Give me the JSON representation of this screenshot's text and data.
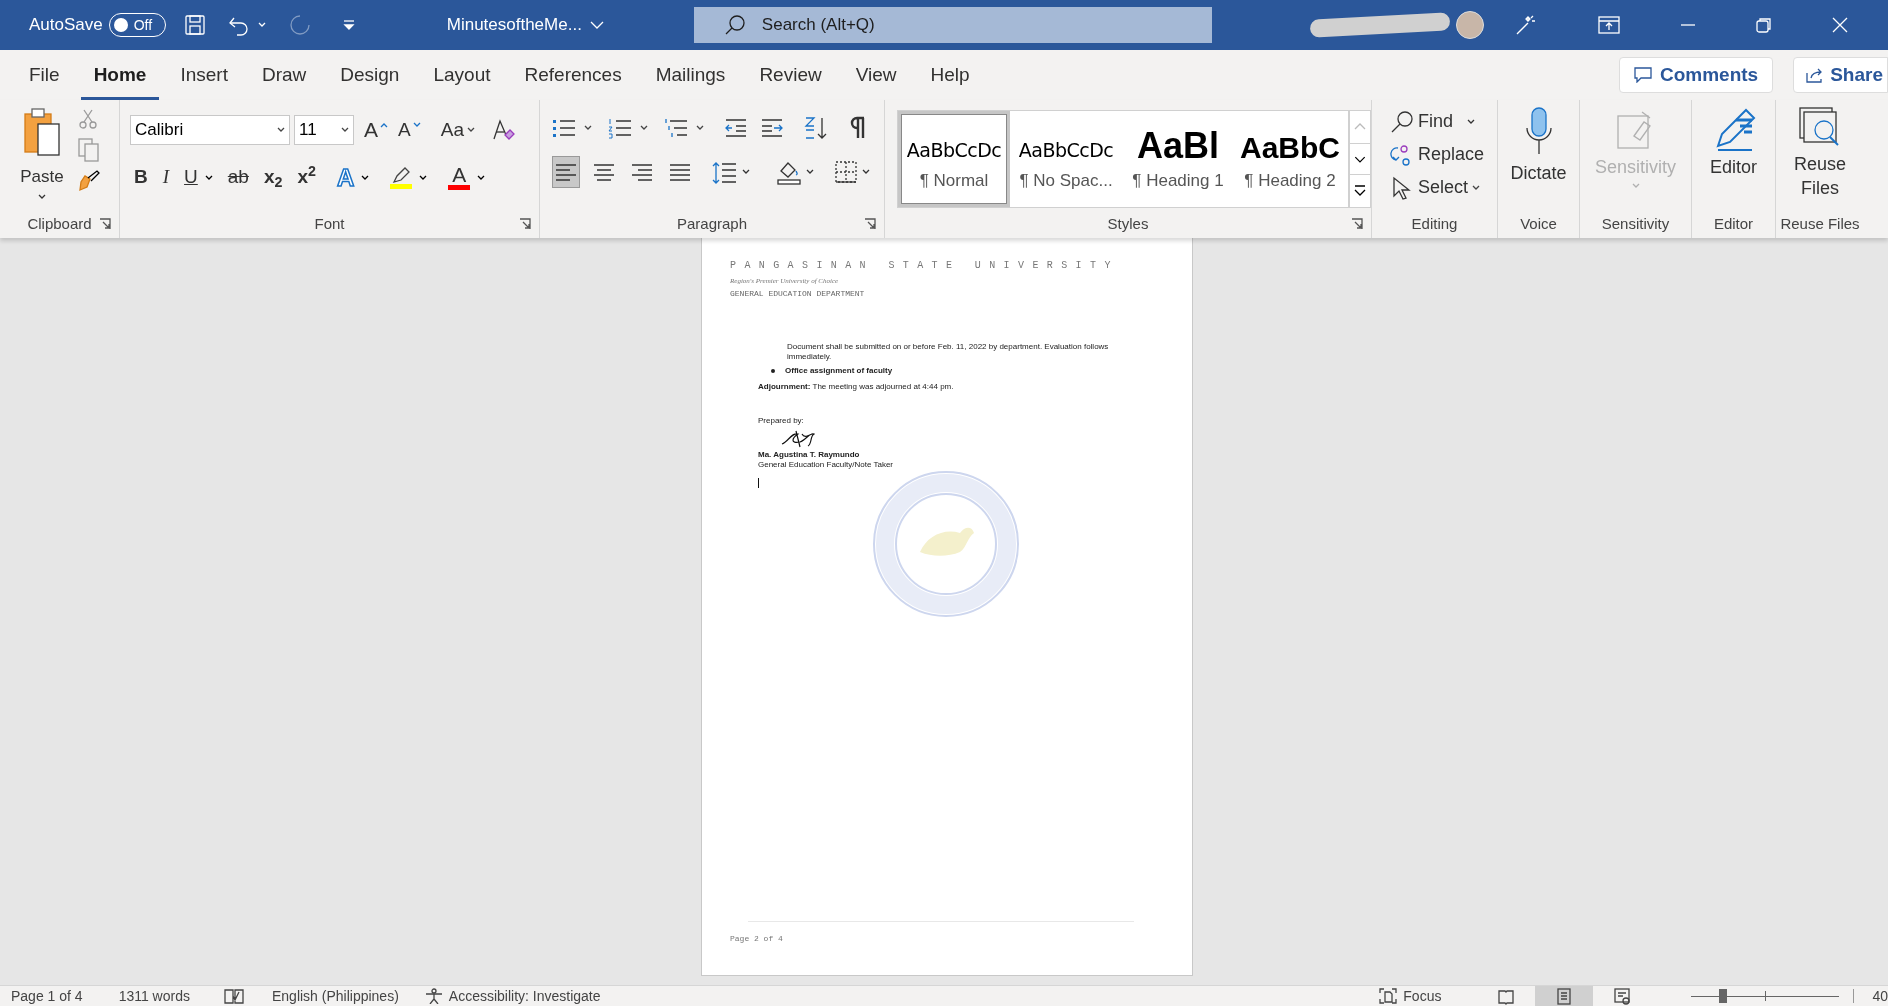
{
  "title_bar": {
    "autosave_label": "AutoSave",
    "autosave_toggle": {
      "label": "Off",
      "on": false
    },
    "document_title": "MinutesoftheMe...",
    "search": {
      "placeholder": "Search (Alt+Q)"
    }
  },
  "menu_tabs": [
    {
      "label": "File",
      "selected": false
    },
    {
      "label": "Home",
      "selected": true
    },
    {
      "label": "Insert",
      "selected": false
    },
    {
      "label": "Draw",
      "selected": false
    },
    {
      "label": "Design",
      "selected": false
    },
    {
      "label": "Layout",
      "selected": false
    },
    {
      "label": "References",
      "selected": false
    },
    {
      "label": "Mailings",
      "selected": false
    },
    {
      "label": "Review",
      "selected": false
    },
    {
      "label": "View",
      "selected": false
    },
    {
      "label": "Help",
      "selected": false
    }
  ],
  "comments_button": "Comments",
  "share_button": "Share",
  "ribbon": {
    "clipboard": {
      "paste": "Paste",
      "label": "Clipboard"
    },
    "font": {
      "font_name": "Calibri",
      "font_size": "11",
      "grow": "A",
      "shrink": "A",
      "change_case": "Aa",
      "format_buttons": [
        {
          "label": "B",
          "kind": "bold"
        },
        {
          "label": "I",
          "kind": "italic"
        },
        {
          "label": "U",
          "kind": "underline"
        },
        {
          "label": "ab",
          "kind": "strike"
        },
        {
          "label": "x$_{2}$",
          "kind": "sub"
        },
        {
          "label": "x$^{2}$",
          "kind": "sup"
        }
      ],
      "text_effects": "A",
      "font_color_label": "A",
      "label": "Font"
    },
    "paragraph": {
      "label": "Paragraph",
      "alignments": [
        {
          "kind": "left",
          "selected": true
        },
        {
          "kind": "center",
          "selected": false
        },
        {
          "kind": "right",
          "selected": false
        },
        {
          "kind": "justify",
          "selected": false
        }
      ]
    },
    "styles": {
      "items": [
        {
          "preview": "AaBbCcDc",
          "name": "¶ Normal",
          "kind": "body",
          "selected": true
        },
        {
          "preview": "AaBbCcDc",
          "name": "¶ No Spac...",
          "kind": "body",
          "selected": false
        },
        {
          "preview": "AaBl",
          "name": "¶ Heading 1",
          "kind": "heading1",
          "selected": false
        },
        {
          "preview": "AaBbC",
          "name": "¶ Heading 2",
          "kind": "heading2",
          "selected": false
        }
      ],
      "label": "Styles"
    },
    "editing": {
      "find": "Find",
      "replace": "Replace",
      "select": "Select",
      "label": "Editing"
    },
    "voice": {
      "button": "Dictate",
      "label": "Voice"
    },
    "sensitivity": {
      "button": "Sensitivity",
      "disabled": true,
      "label": "Sensitivity"
    },
    "editor": {
      "button": "Editor",
      "label": "Editor"
    },
    "reuse_files": {
      "button": "Reuse Files",
      "label": "Reuse Files"
    }
  },
  "document": {
    "header": {
      "university": "PANGASINAN STATE UNIVERSITY",
      "tagline": "Region's Premier University of Choice",
      "department": "GENERAL EDUCATION DEPARTMENT"
    },
    "body": [
      {
        "kind": "indented",
        "text": "Document shall be submitted on or before Feb. 11, 2022 by department. Evaluation follows immediately."
      },
      {
        "kind": "bullet",
        "text": "Office assignment of faculty"
      },
      {
        "kind": "paragraph",
        "text": "**Adjournment:** The meeting was adjourned at 4:44 pm."
      }
    ],
    "prepared_by": "Prepared by:",
    "signer_name": "Ma. Agustina T. Raymundo",
    "signer_title": "General Education Faculty/Note Taker",
    "footer": "Page 2 of 4"
  },
  "status_bar": {
    "page": "Page 1 of 4",
    "words": "1311 words",
    "language": "English (Philippines)",
    "accessibility": "Accessibility: Investigate",
    "focus": "Focus",
    "views": [
      {
        "kind": "read",
        "selected": false
      },
      {
        "kind": "print",
        "selected": true
      },
      {
        "kind": "web",
        "selected": false
      }
    ],
    "level": 0.2,
    "zoom": "40"
  }
}
